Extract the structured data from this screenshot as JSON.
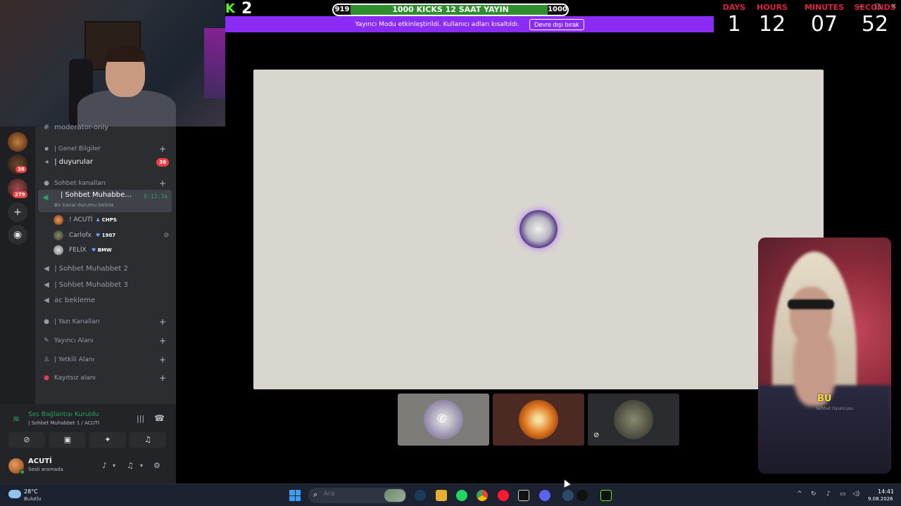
{
  "overlay": {
    "kick_logo": "K",
    "kick_count": "2",
    "goal": {
      "current": "919",
      "target": "1000",
      "title": "1000 KICKS 12 SAAT YAYIN",
      "progress": 0.919
    },
    "streamer_mode": {
      "text": "Yayıncı Modu etkinleştirildi. Kullanıcı adları kısaltıldı.",
      "button": "Devre dışı bırak"
    },
    "countdown": [
      {
        "label": "DAYS",
        "value": "1"
      },
      {
        "label": "HOURS",
        "value": "12"
      },
      {
        "label": "MINUTES",
        "value": "07"
      },
      {
        "label": "SECONDS",
        "value": "52"
      }
    ]
  },
  "servers": {
    "badges": [
      "38",
      "279"
    ],
    "add_icon": "plus-icon",
    "explore_icon": "compass-icon"
  },
  "channels": {
    "moderator_only": "moderator-only",
    "cat_genel": "| Genel Bilgiler",
    "duyurular": "| duyurular",
    "duyurular_badge": "38",
    "cat_sohbet": "Sohbet kanalları",
    "active_voice": {
      "title": "| Sohbet Muhabbe...",
      "timer": "6:11:34",
      "status": "Bir kanal durumu belirle"
    },
    "voice_users": [
      {
        "name": "! ACUTİ",
        "tag": "CHPS"
      },
      {
        "name": "Carlofx",
        "tag": "1907"
      },
      {
        "name": "FELİX",
        "tag": "BMW"
      }
    ],
    "sohbet2": "| Sohbet Muhabbet 2",
    "sohbet3": "| Sohbet Muhabbet 3",
    "ac_bekleme": "ac bekleme",
    "cat_yazi": "| Yazı Kanalları",
    "cat_yayinci": "Yayıncı Alanı",
    "cat_yetkili": "| Yetkili Alanı",
    "cat_kayitsiz": "Kayıtsız alanı"
  },
  "voice_panel": {
    "title": "Ses Bağlantısı Kuruldu",
    "subtitle": "| Sohbet Muhabbet 1 / ACUTİ",
    "user_name": "ACUTİ",
    "user_status": "Sesli aramada"
  },
  "stage": {
    "cam_caption": "BU",
    "cam_subcaption": "Sohbet Oyuncusu"
  },
  "taskbar": {
    "weather_temp": "28°C",
    "weather_desc": "Bulutlu",
    "search_placeholder": "Ara",
    "time": "14:41",
    "date": "9.08.2026"
  },
  "colors": {
    "streamer_bar": "#8b2cf5",
    "countdown_label": "#e0213a",
    "voice_connected": "#23a55a",
    "kick_green": "#53fc18"
  }
}
